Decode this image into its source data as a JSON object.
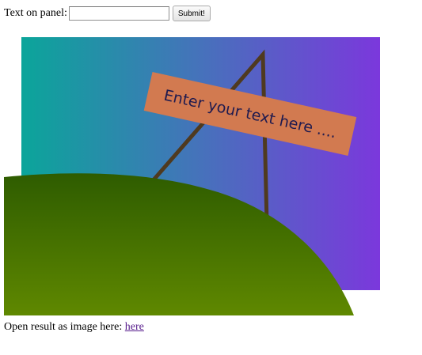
{
  "form": {
    "label": "Text on panel:",
    "input_value": "",
    "input_placeholder": "",
    "submit_label": "Submit!"
  },
  "scene": {
    "panel_text": "Enter your text here ....",
    "colors": {
      "sky_left": "#0ba59a",
      "sky_mid": "#4672bb",
      "sky_right": "#7b38dc",
      "sign_panel": "#d27a50",
      "sign_post": "#4f3a1f",
      "panel_text": "#1e1a4f",
      "hill_top": "#2e5c00",
      "hill_bottom": "#5f8800"
    }
  },
  "footer": {
    "text": "Open result as image here:",
    "link_label": "here"
  }
}
